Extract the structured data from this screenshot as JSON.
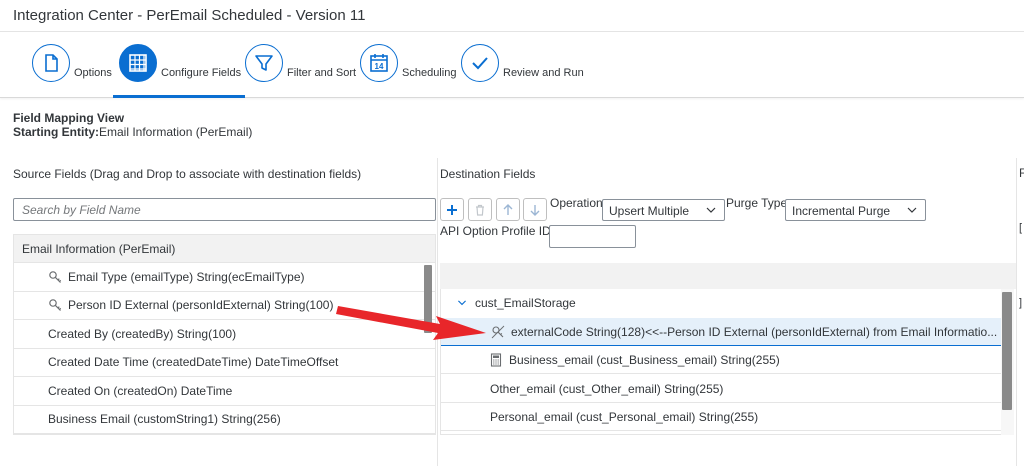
{
  "window": {
    "title": "Integration Center - PerEmail Scheduled - Version 11"
  },
  "steps": [
    {
      "label": "Options",
      "icon": "document-icon",
      "active": false
    },
    {
      "label": "Configure Fields",
      "icon": "grid-icon",
      "active": true
    },
    {
      "label": "Filter and Sort",
      "icon": "filter-icon",
      "active": false
    },
    {
      "label": "Scheduling",
      "icon": "calendar-icon",
      "calendar_day": "14",
      "active": false
    },
    {
      "label": "Review and Run",
      "icon": "checkmark-icon",
      "active": false
    }
  ],
  "mapping": {
    "view_title": "Field Mapping View",
    "starting_entity_label": "Starting Entity:",
    "starting_entity_value": "Email Information (PerEmail)"
  },
  "source": {
    "header": "Source Fields (Drag and Drop to associate with destination fields)",
    "search_placeholder": "Search by Field Name",
    "group": "Email Information (PerEmail)",
    "rows": [
      {
        "text": "Email Type (emailType) String(ecEmailType)",
        "icon": "key-icon"
      },
      {
        "text": "Person ID External (personIdExternal) String(100)",
        "icon": "key-icon"
      },
      {
        "text": "Created By (createdBy) String(100)",
        "icon": ""
      },
      {
        "text": "Created Date Time (createdDateTime) DateTimeOffset",
        "icon": ""
      },
      {
        "text": "Created On (createdOn) DateTime",
        "icon": ""
      },
      {
        "text": "Business Email (customString1) String(256)",
        "icon": ""
      }
    ]
  },
  "destination": {
    "header": "Destination Fields",
    "operation_label": "Operation",
    "operation_value": "Upsert Multiple",
    "purge_label": "Purge Type",
    "purge_value": "Incremental Purge",
    "api_label": "API Option Profile ID",
    "api_value": "",
    "group": "cust_EmailStorage",
    "rows": [
      {
        "text": "externalCode String(128)<<--Person ID External (personIdExternal) from Email Informatio...",
        "icon": "mapped-key-icon",
        "selected": true
      },
      {
        "text": "Business_email (cust_Business_email) String(255)",
        "icon": "calculator-icon",
        "selected": false
      },
      {
        "text": "Other_email (cust_Other_email) String(255)",
        "icon": "",
        "selected": false
      },
      {
        "text": "Personal_email (cust_Personal_email) String(255)",
        "icon": "",
        "selected": false
      }
    ]
  },
  "far_panel": {
    "header": "F",
    "marker1": "[",
    "marker2": "]"
  },
  "colors": {
    "accent": "#0a6ed1",
    "annotation_arrow": "#e8262a"
  }
}
